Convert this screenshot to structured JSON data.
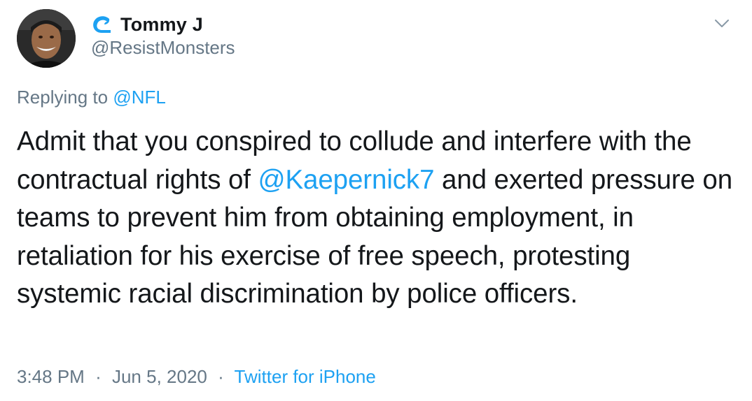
{
  "user": {
    "display_name": "Tommy J",
    "handle": "@ResistMonsters",
    "badge_icon": "wave-icon",
    "avatar_icon": "profile-photo"
  },
  "reply": {
    "prefix": "Replying to",
    "mention": "@NFL"
  },
  "tweet": {
    "text_1": "Admit that you conspired to collude and interfere with the contractual rights of ",
    "mention": "@Kaepernick7",
    "text_2": " and exerted pressure on teams to prevent him from obtaining employment, in retaliation for his exercise of free speech, protesting systemic racial discrimination by police officers."
  },
  "meta": {
    "time": "3:48 PM",
    "date": "Jun 5, 2020",
    "separator": "·",
    "source": "Twitter for iPhone"
  },
  "menu": {
    "icon": "chevron-down-icon"
  },
  "colors": {
    "link": "#1da1f2",
    "secondary_text": "#657786",
    "primary_text": "#14171a"
  }
}
